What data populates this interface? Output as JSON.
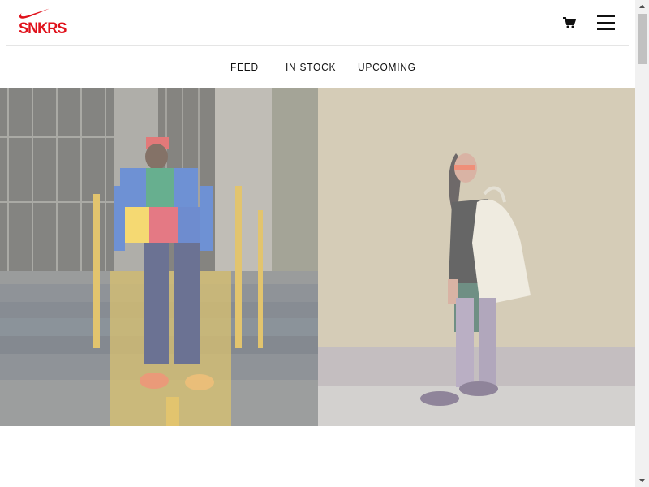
{
  "brand": {
    "logo_icon": "swoosh-icon",
    "logo_text": "SNKRS",
    "accent_color": "#e0111b"
  },
  "header": {
    "cart_icon": "cart-icon",
    "menu_icon": "hamburger-menu-icon"
  },
  "nav": {
    "items": [
      {
        "label": "FEED"
      },
      {
        "label": "IN STOCK"
      },
      {
        "label": "UPCOMING"
      }
    ]
  },
  "hero": {
    "panels": [
      {
        "name": "street-photo-colorblock-jacket"
      },
      {
        "name": "street-photo-tote-bag"
      }
    ]
  },
  "scrollbar": {
    "up_icon": "scroll-up-arrow-icon",
    "down_icon": "scroll-down-arrow-icon"
  }
}
